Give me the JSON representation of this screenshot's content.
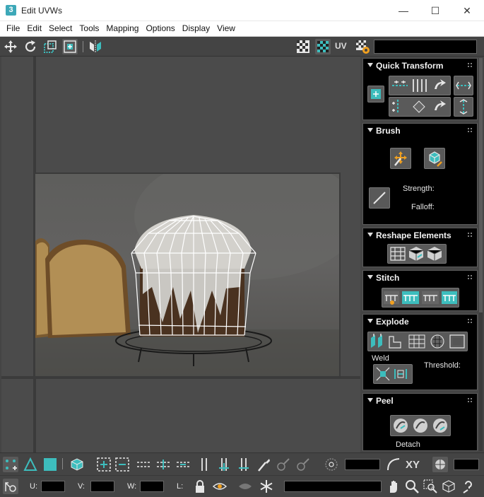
{
  "window": {
    "app_icon_glyph": "3",
    "title": "Edit UVWs",
    "minimize_glyph": "—",
    "maximize_glyph": "☐",
    "close_glyph": "✕"
  },
  "menu": [
    "File",
    "Edit",
    "Select",
    "Tools",
    "Mapping",
    "Options",
    "Display",
    "View"
  ],
  "top_toolbar": {
    "uv_label": "UV",
    "icons": [
      "move-icon",
      "rotate-icon",
      "scale-icon",
      "freeform-icon",
      "mirror-icon",
      "checker-icon",
      "checker-pattern-icon",
      "uv-settings-icon"
    ]
  },
  "panels": {
    "quick_transform": {
      "title": "Quick Transform"
    },
    "brush": {
      "title": "Brush",
      "strength_label": "Strength:",
      "falloff_label": "Falloff:"
    },
    "reshape": {
      "title": "Reshape Elements"
    },
    "stitch": {
      "title": "Stitch"
    },
    "explode": {
      "title": "Explode",
      "weld_label": "Weld",
      "threshold_label": "Threshold:"
    },
    "peel": {
      "title": "Peel",
      "detach_label": "Detach"
    }
  },
  "bottom_toolbar": {
    "xy_label": "XY",
    "u_label": "U:",
    "v_label": "V:",
    "w_label": "W:",
    "l_label": "L:"
  },
  "colors": {
    "accent_teal": "#3dbdbd",
    "panel_black": "#000000",
    "toolbar_gray": "#444444",
    "uv_mesh_white": "#ffffff"
  }
}
